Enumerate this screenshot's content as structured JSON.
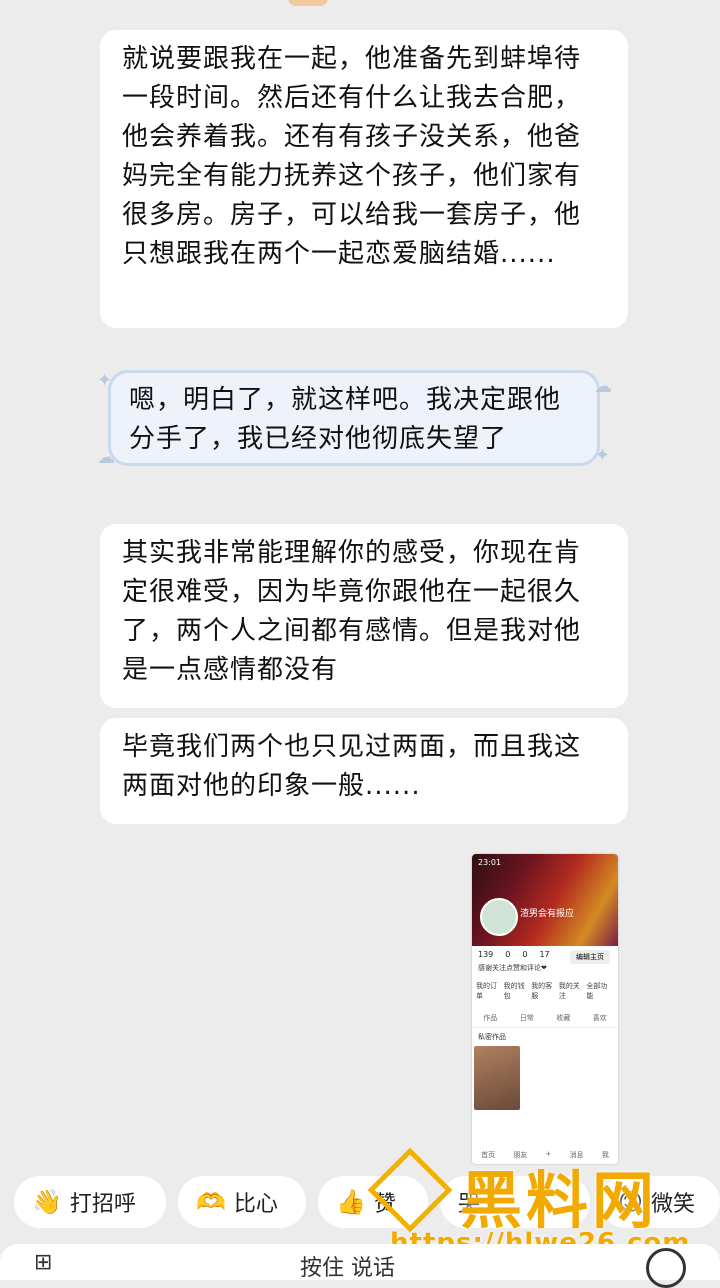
{
  "messages": [
    {
      "text": "就说要跟我在一起，他准备先到蚌埠待一段时间。然后还有什么让我去合肥，他会养着我。还有有孩子没关系，他爸妈完全有能力抚养这个孩子，他们家有很多房。房子，可以给我一套房子，他只想跟我在两个一起恋爱脑结婚......"
    },
    {
      "text": "嗯，明白了，就这样吧。我决定跟他分手了，我已经对他彻底失望了"
    },
    {
      "text": "其实我非常能理解你的感受，你现在肯定很难受，因为毕竟你跟他在一起很久了，两个人之间都有感情。但是我对他是一点感情都没有"
    },
    {
      "text": "毕竟我们两个也只见过两面，而且我这两面对他的印象一般......"
    }
  ],
  "screenshot": {
    "time": "23:01",
    "name": "渣男会有报应",
    "stats": [
      "139",
      "0",
      "0",
      "17"
    ],
    "edit": "编辑主页",
    "bio": "感谢关注点赞和评论❤",
    "icons": [
      "我的订单",
      "我的钱包",
      "我的客服",
      "我的关注",
      "全部功能"
    ],
    "tabs": [
      "作品",
      "日常",
      "收藏",
      "喜欢"
    ],
    "private": "私密作品",
    "nav": [
      "首页",
      "朋友",
      "+",
      "消息",
      "我"
    ]
  },
  "chips": [
    {
      "icon": "wave-emoji",
      "label": "打招呼"
    },
    {
      "icon": "heart-hands-emoji",
      "label": "比心"
    },
    {
      "icon": "thumbs-up-emoji",
      "label": "赞"
    },
    {
      "icon": "",
      "label": "哭"
    },
    {
      "icon": "smile-emoji",
      "label": "微笑"
    }
  ],
  "watermark": {
    "title": "黑料网",
    "url": "https://hlwe26.com"
  },
  "input": {
    "placeholder": "按住 说话"
  }
}
